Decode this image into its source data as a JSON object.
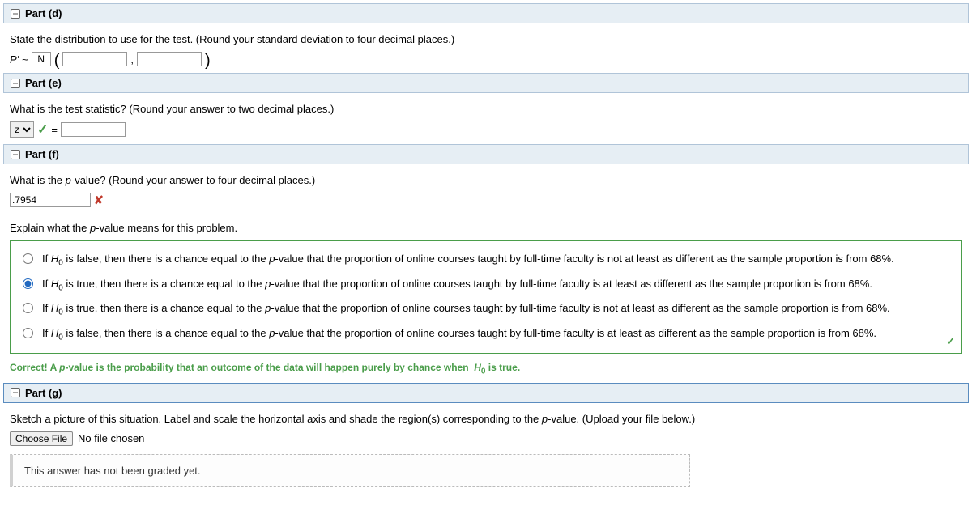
{
  "parts": {
    "d": {
      "header": "Part (d)",
      "prompt": "State the distribution to use for the test. (Round your standard deviation to four decimal places.)",
      "pprime": "P'",
      "tilde": "~",
      "dist_letter": "N",
      "mean": "",
      "comma": ",",
      "sd": ""
    },
    "e": {
      "header": "Part (e)",
      "prompt": "What is the test statistic? (Round your answer to two decimal places.)",
      "stat_select": "z",
      "equals": "=",
      "stat_value": ""
    },
    "f": {
      "header": "Part (f)",
      "prompt_before_p": "What is the ",
      "p_text": "p",
      "prompt_after_p": "-value? (Round your answer to four decimal places.)",
      "p_value": ".7954",
      "explain_before_p": "Explain what the ",
      "explain_after_p": "-value means for this problem.",
      "options": [
        {
          "before_h0": "If ",
          "h0": "H",
          "sub": "0",
          "after": " is false, then there is a chance equal to the ",
          "p": "p",
          "tail": "-value that the proportion of online courses taught by full-time faculty is not at least as different as the sample proportion is from 68%."
        },
        {
          "before_h0": "If ",
          "h0": "H",
          "sub": "0",
          "after": " is true, then there is a chance equal to the ",
          "p": "p",
          "tail": "-value that the proportion of online courses taught by full-time faculty is at least as different as the sample proportion is from 68%."
        },
        {
          "before_h0": "If ",
          "h0": "H",
          "sub": "0",
          "after": " is true, then there is a chance equal to the ",
          "p": "p",
          "tail": "-value that the proportion of online courses taught by full-time faculty is not at least as different as the sample proportion is from 68%."
        },
        {
          "before_h0": "If ",
          "h0": "H",
          "sub": "0",
          "after": " is false, then there is a chance equal to the ",
          "p": "p",
          "tail": "-value that the proportion of online courses taught by full-time faculty is at least as different as the sample proportion is from 68%."
        }
      ],
      "selected": 1,
      "correct_before_p": "Correct! A ",
      "correct_after_p": "-value is the probability that an outcome of the data will happen purely by chance when ",
      "correct_h0": "H",
      "correct_sub": "0",
      "correct_tail": " is true."
    },
    "g": {
      "header": "Part (g)",
      "prompt_before": "Sketch a picture of this situation. Label and scale the horizontal axis and shade the region(s) corresponding to the ",
      "p": "p",
      "prompt_after": "-value. (Upload your file below.)",
      "choose_file": "Choose File",
      "no_file": "No file chosen",
      "not_graded": "This answer has not been graded yet."
    }
  }
}
